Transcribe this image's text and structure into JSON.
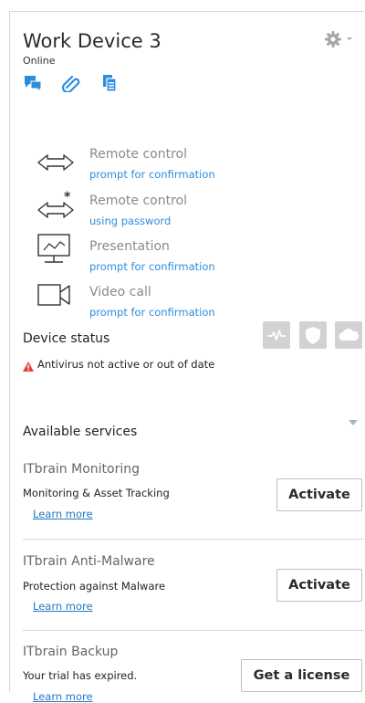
{
  "device": {
    "name": "Work Device 3",
    "status": "Online"
  },
  "toolbar_icons": [
    "chat-icon",
    "paperclip-icon",
    "file-transfer-icon"
  ],
  "settings_icon": "gear-icon",
  "connections": [
    {
      "icon": "remote-control-icon",
      "title": "Remote control",
      "subtitle": "prompt for confirmation"
    },
    {
      "icon": "remote-control-password-icon",
      "title": "Remote control",
      "subtitle": "using password"
    },
    {
      "icon": "presentation-icon",
      "title": "Presentation",
      "subtitle": "prompt for confirmation"
    },
    {
      "icon": "video-call-icon",
      "title": "Video call",
      "subtitle": "prompt for confirmation"
    }
  ],
  "device_status": {
    "title": "Device status",
    "warning": "Antivirus not active or out of date",
    "indicators": [
      "heartbeat-icon",
      "shield-icon",
      "cloud-icon"
    ]
  },
  "services": {
    "title": "Available services",
    "items": [
      {
        "name": "ITbrain Monitoring",
        "description": "Monitoring & Asset Tracking",
        "link": "Learn more",
        "action": "Activate"
      },
      {
        "name": "ITbrain Anti-Malware",
        "description": "Protection against Malware",
        "link": "Learn more",
        "action": "Activate"
      },
      {
        "name": "ITbrain Backup",
        "description": "Your trial has expired.",
        "link": "Learn more",
        "action": "Get a license"
      }
    ]
  },
  "colors": {
    "accent": "#2c8de0",
    "link": "#1f78c8",
    "warning": "#e0403a",
    "status_box": "#d2d2d2"
  }
}
